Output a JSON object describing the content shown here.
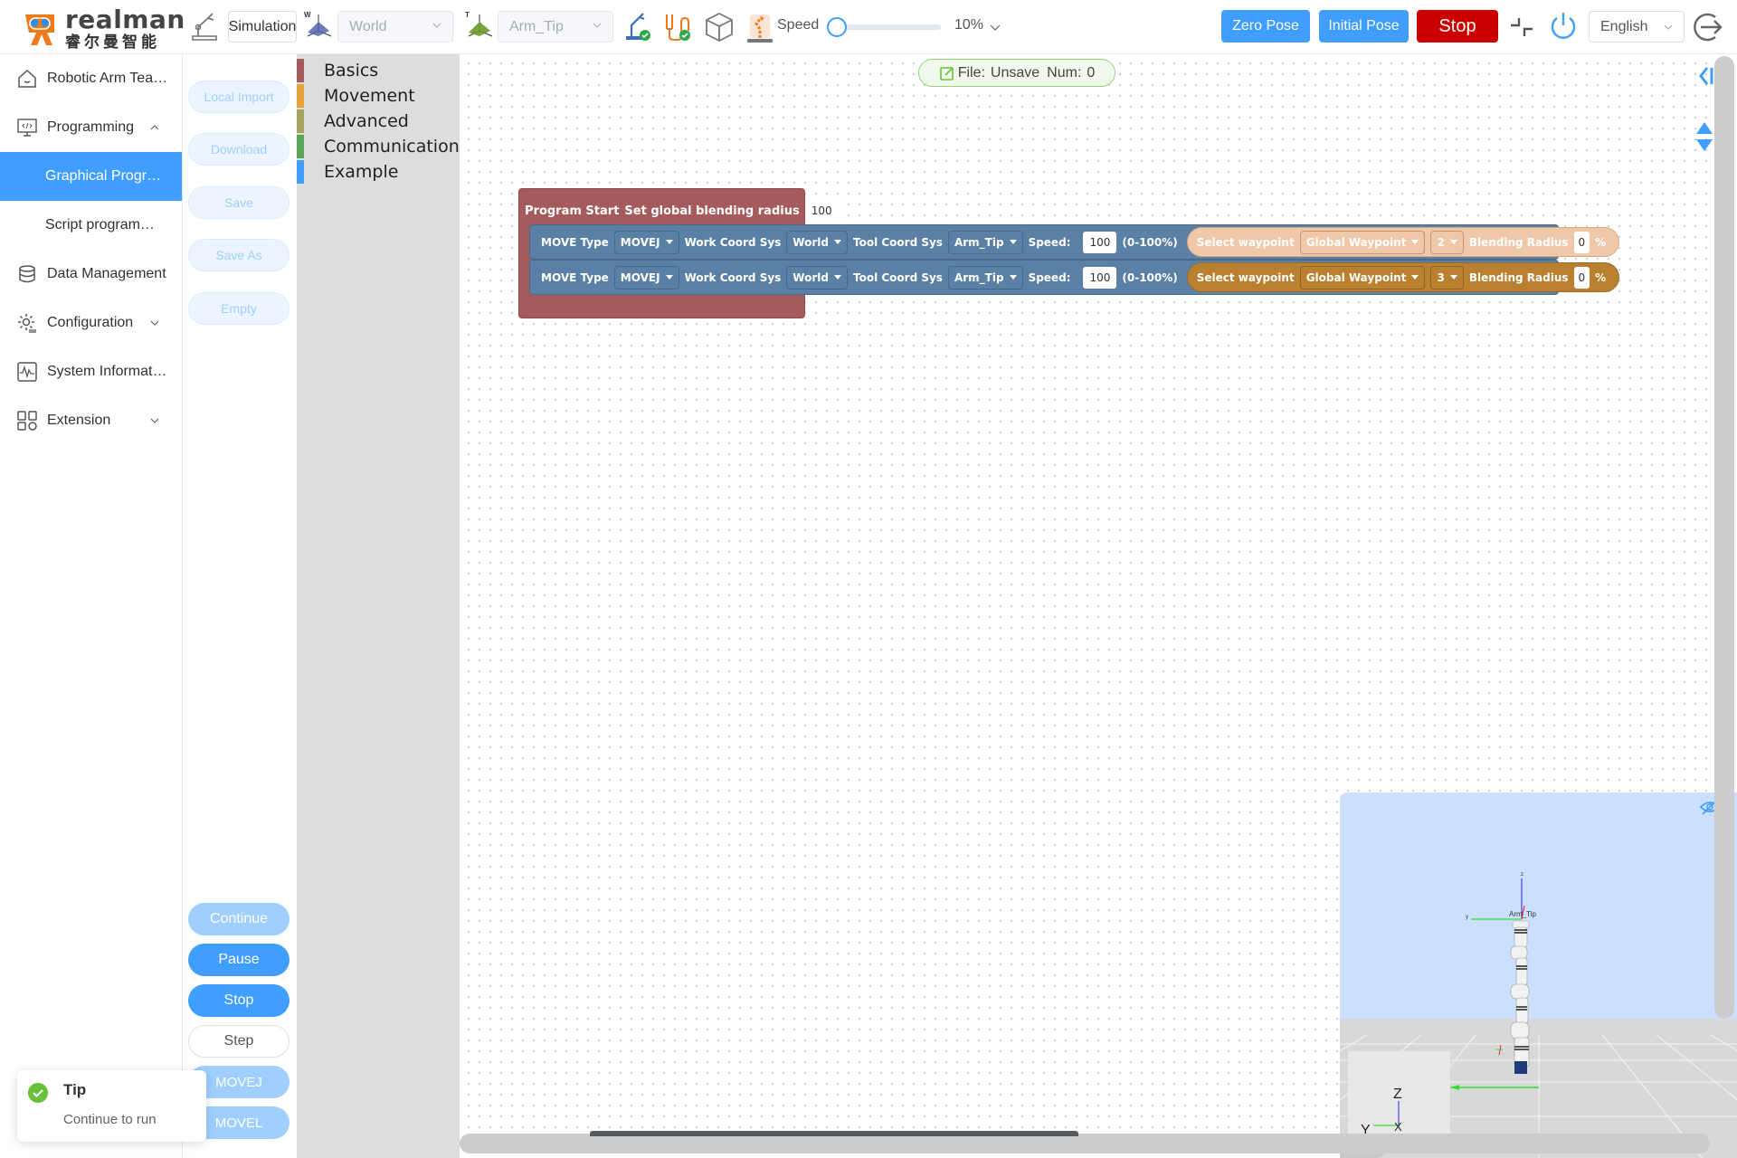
{
  "brand": {
    "name_en": "realman",
    "name_cn": "睿尔曼智能"
  },
  "header": {
    "mode": "Simulation",
    "work_coord": {
      "prefix": "W",
      "value": "World"
    },
    "tool_coord": {
      "prefix": "T",
      "value": "Arm_Tip"
    },
    "speed_label": "Speed",
    "speed_value": "10%",
    "speed_fraction": 0.1,
    "zero_pose_label": "Zero Pose",
    "initial_pose_label": "Initial Pose",
    "stop_label": "Stop",
    "language": "English"
  },
  "sidebar": {
    "items": [
      {
        "label": "Robotic Arm Tea…",
        "icon": "home-icon"
      },
      {
        "label": "Programming",
        "icon": "code-monitor-icon",
        "expanded": true
      },
      {
        "label": "Graphical Progr…",
        "active": true
      },
      {
        "label": "Script programm…"
      },
      {
        "label": "Data Management",
        "icon": "database-icon"
      },
      {
        "label": "Configuration",
        "icon": "gear-icon"
      },
      {
        "label": "System Informat…",
        "icon": "pulse-icon"
      },
      {
        "label": "Extension",
        "icon": "grid-icon"
      }
    ]
  },
  "actions": {
    "local_import": "Local Import",
    "download": "Download",
    "save": "Save",
    "save_as": "Save As",
    "empty": "Empty",
    "continue": "Continue",
    "pause": "Pause",
    "stop": "Stop",
    "step": "Step",
    "movej": "MOVEJ",
    "movel": "MOVEL"
  },
  "toolbox": {
    "categories": [
      {
        "label": "Basics",
        "color": "#a55b5b"
      },
      {
        "label": "Movement",
        "color": "#e8a23b"
      },
      {
        "label": "Advanced",
        "color": "#a5a55b"
      },
      {
        "label": "Communication",
        "color": "#5ba55b"
      },
      {
        "label": "Example",
        "color": "#409eff"
      }
    ]
  },
  "file_status": {
    "file_label": "File:",
    "file_value": "Unsave",
    "num_label": "Num:",
    "num_value": "0"
  },
  "program": {
    "start_label": "Program Start",
    "blend_label": "Set global blending radius",
    "blend_value": "100",
    "blend_unit": "%",
    "moves": [
      {
        "move_type_label": "MOVE Type",
        "move_type": "MOVEJ",
        "work_label": "Work Coord Sys",
        "work": "World",
        "tool_label": "Tool Coord Sys",
        "tool": "Arm_Tip",
        "speed_label": "Speed:",
        "speed": "100",
        "speed_range": "(0-100%)",
        "waypoint_label": "Select waypoint",
        "waypoint_type": "Global Waypoint",
        "waypoint_index": "2",
        "blend_label": "Blending Radius",
        "blend": "0",
        "blend_unit": "%",
        "selected": true
      },
      {
        "move_type_label": "MOVE Type",
        "move_type": "MOVEJ",
        "work_label": "Work Coord Sys",
        "work": "World",
        "tool_label": "Tool Coord Sys",
        "tool": "Arm_Tip",
        "speed_label": "Speed:",
        "speed": "100",
        "speed_range": "(0-100%)",
        "waypoint_label": "Select waypoint",
        "waypoint_type": "Global Waypoint",
        "waypoint_index": "3",
        "blend_label": "Blending Radius",
        "blend": "0",
        "blend_unit": "%",
        "selected": false
      }
    ]
  },
  "viewer": {
    "tcp_label": "Arm_Tip",
    "axis_labels": {
      "z": "Z",
      "y": "Y",
      "x": "X"
    }
  },
  "toast": {
    "title": "Tip",
    "message": "Continue to run"
  },
  "colors": {
    "primary": "#409eff",
    "danger": "#cc0000",
    "success": "#67c23a",
    "block_start": "#a55b5b",
    "block_move": "#5b80a5"
  }
}
